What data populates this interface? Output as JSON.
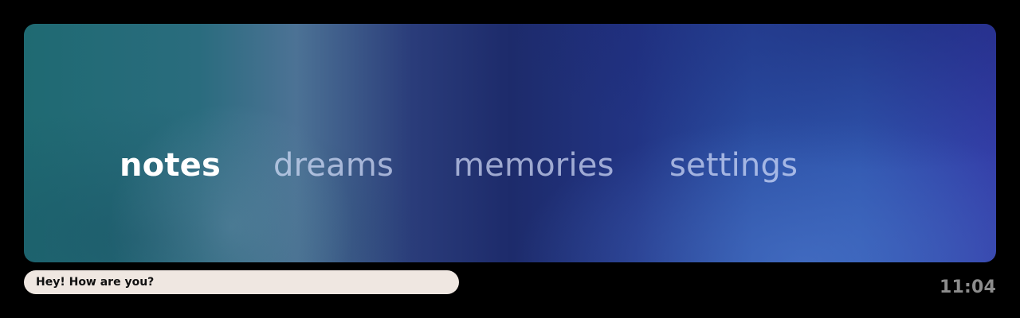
{
  "navigation": {
    "items": [
      {
        "label": "notes",
        "state": "active"
      },
      {
        "label": "dreams",
        "state": "inactive"
      },
      {
        "label": "memories",
        "state": "inactive"
      },
      {
        "label": "settings",
        "state": "inactive"
      }
    ]
  },
  "message": {
    "text": "Hey! How are you?"
  },
  "status": {
    "time": "11:04"
  },
  "colors": {
    "background": "#000000",
    "nav_active": "#ffffff",
    "nav_inactive": "#c7d0f0",
    "message_bg": "#efe7e1",
    "clock": "#8c8c8c"
  }
}
